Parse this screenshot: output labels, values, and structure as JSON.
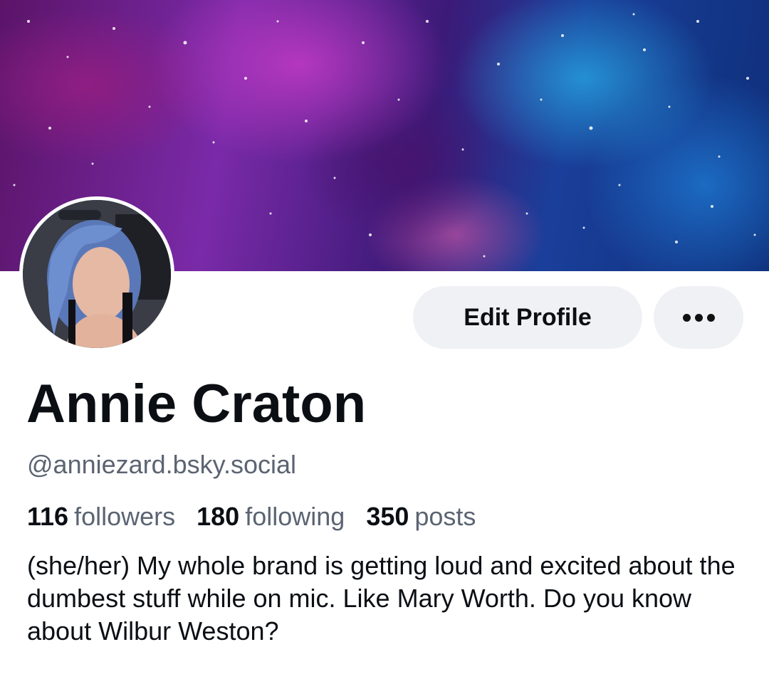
{
  "profile": {
    "display_name": "Annie Craton",
    "handle": "@anniezard.bsky.social",
    "bio": "(she/her) My whole brand is getting loud and excited about the dumbest stuff while on mic. Like Mary Worth. Do you know about Wilbur Weston?",
    "avatar_icon": "user-avatar-photo",
    "banner_icon": "space-nebula-banner"
  },
  "stats": {
    "followers_count": "116",
    "followers_label": "followers",
    "following_count": "180",
    "following_label": "following",
    "posts_count": "350",
    "posts_label": "posts"
  },
  "actions": {
    "edit_profile_label": "Edit Profile",
    "more_icon": "ellipsis-icon"
  },
  "colors": {
    "button_bg": "#f0f1f5",
    "muted_text": "#5b6472",
    "text": "#0b0f14"
  }
}
